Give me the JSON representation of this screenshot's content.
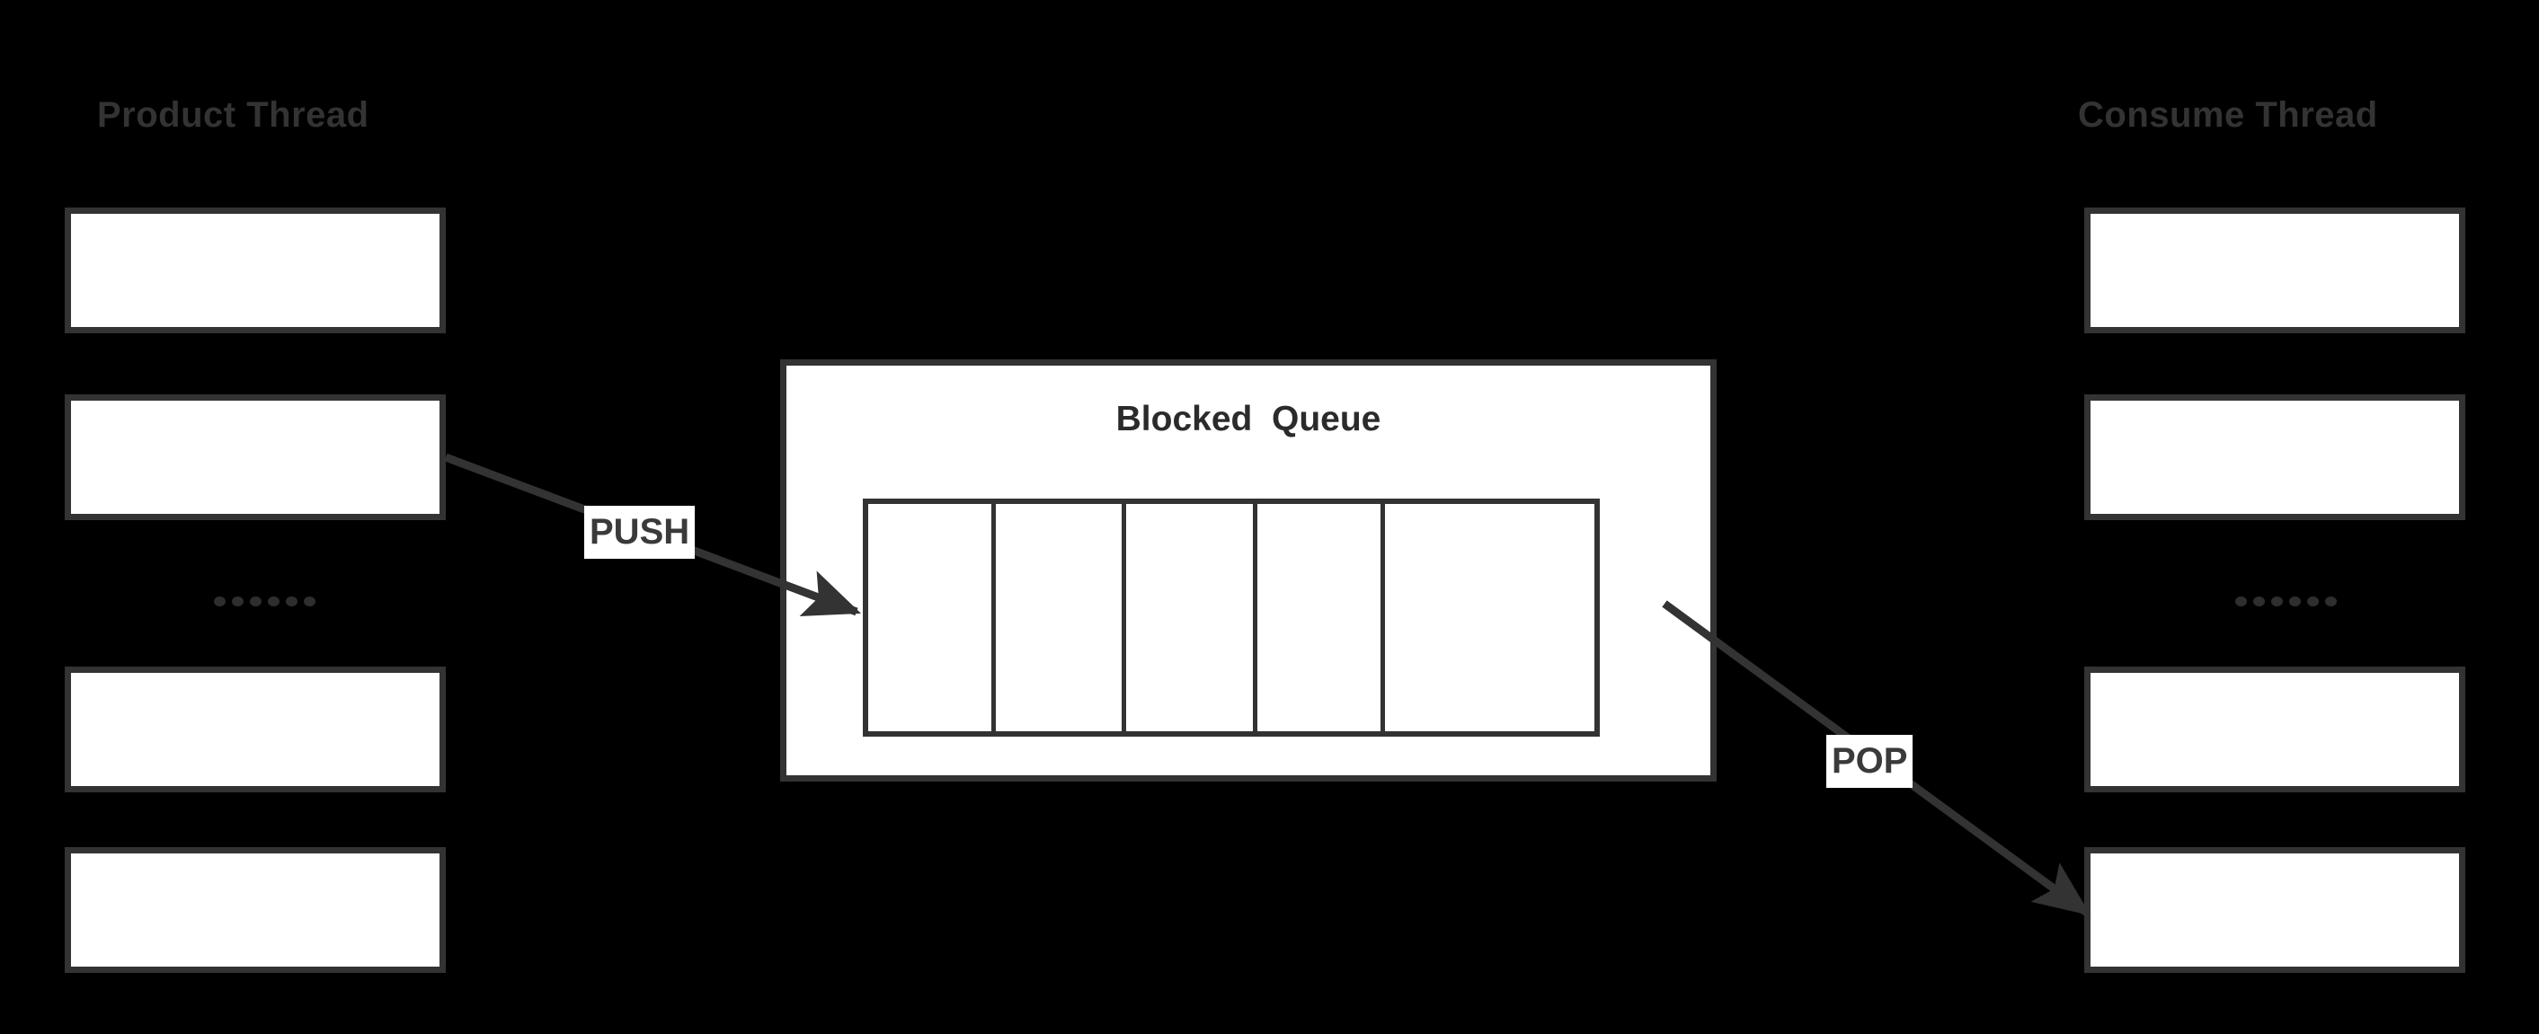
{
  "diagram": {
    "title": "Producer-Consumer Blocked Queue",
    "background_color": "#000000",
    "stroke_color": "#333333",
    "fill_color": "#ffffff",
    "label_text_color": "#3a3a3a"
  },
  "producer": {
    "heading": "Product Thread",
    "ellipsis": "......",
    "boxes": [
      {
        "label": ""
      },
      {
        "label": ""
      },
      {
        "label": ""
      },
      {
        "label": ""
      }
    ]
  },
  "consumer": {
    "heading": "Consume Thread",
    "ellipsis": "......",
    "boxes": [
      {
        "label": ""
      },
      {
        "label": ""
      },
      {
        "label": ""
      },
      {
        "label": ""
      }
    ]
  },
  "queue": {
    "title": "Blocked  Queue",
    "cells": [
      {
        "label": ""
      },
      {
        "label": ""
      },
      {
        "label": ""
      },
      {
        "label": ""
      },
      {
        "label": ""
      }
    ]
  },
  "edges": {
    "push_label": "PUSH",
    "pop_label": "POP"
  }
}
